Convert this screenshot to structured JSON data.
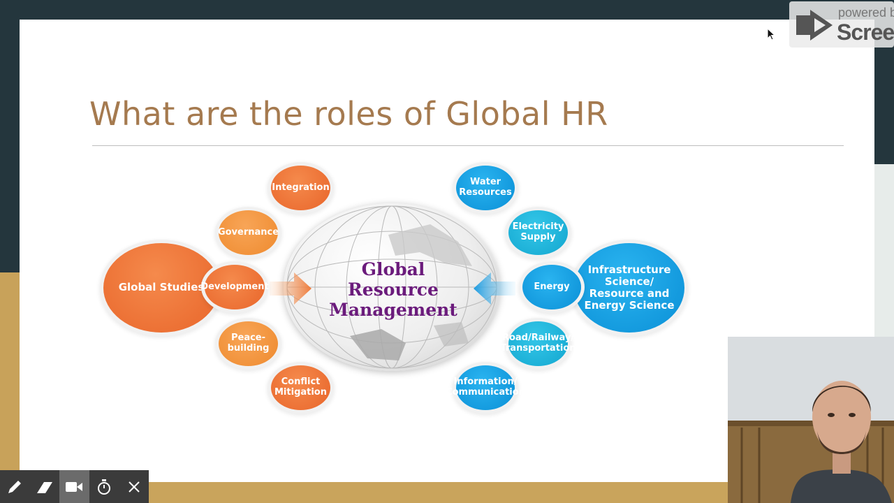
{
  "slide": {
    "title": "What are the roles of Global HR"
  },
  "diagram": {
    "center": [
      "Global",
      "Resource",
      "Management"
    ],
    "left_hub": "Global Studies",
    "left_items": [
      "Integration",
      "Governance",
      "Development",
      "Peace-building",
      "Conflict Mitigation"
    ],
    "right_hub": "Infrastructure Science/ Resource and Energy Science",
    "right_items": [
      "Water Resources",
      "Electricity Supply",
      "Energy",
      "Road/Railway/ Transportation",
      "Information/ Communication"
    ]
  },
  "watermark": {
    "powered": "powered b",
    "brand": "Screen"
  },
  "recorder_toolbar": {
    "tools": [
      "pen-icon",
      "eraser-icon",
      "camera-icon",
      "timer-icon",
      "close-icon"
    ]
  },
  "colors": {
    "title": "#a57a4f",
    "orange": "#e8652a",
    "blue": "#0a8fd6",
    "purple": "#6b1b7c"
  }
}
